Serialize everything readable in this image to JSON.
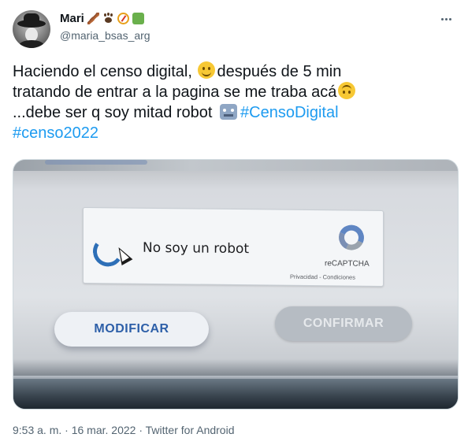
{
  "user": {
    "name": "Mari",
    "handle": "@maria_bsas_arg",
    "name_emojis": [
      "feather-icon",
      "paw-icon",
      "compass-icon",
      "puzzle-icon"
    ]
  },
  "tweet": {
    "line1_a": "Haciendo el censo digital, ",
    "line1_b": "después de 5 min",
    "line2": "tratando de entrar a la pagina se me traba acá",
    "line3_a": "...debe ser q soy mitad robot ",
    "hashtag1": "#CensoDigital",
    "hashtag2": "#censo2022"
  },
  "photo": {
    "captcha_label": "No soy un robot",
    "captcha_brand": "reCAPTCHA",
    "captcha_links": "Privacidad - Condiciones",
    "modify_label": "MODIFICAR",
    "confirm_label": "CONFIRMAR"
  },
  "footer": {
    "time": "9:53 a. m.",
    "separator1": " · ",
    "date": "16 mar. 2022",
    "separator2": " · ",
    "source": "Twitter for Android"
  },
  "colors": {
    "hashtag": "#1d9bf0",
    "text": "#0f1419",
    "muted": "#536471"
  }
}
